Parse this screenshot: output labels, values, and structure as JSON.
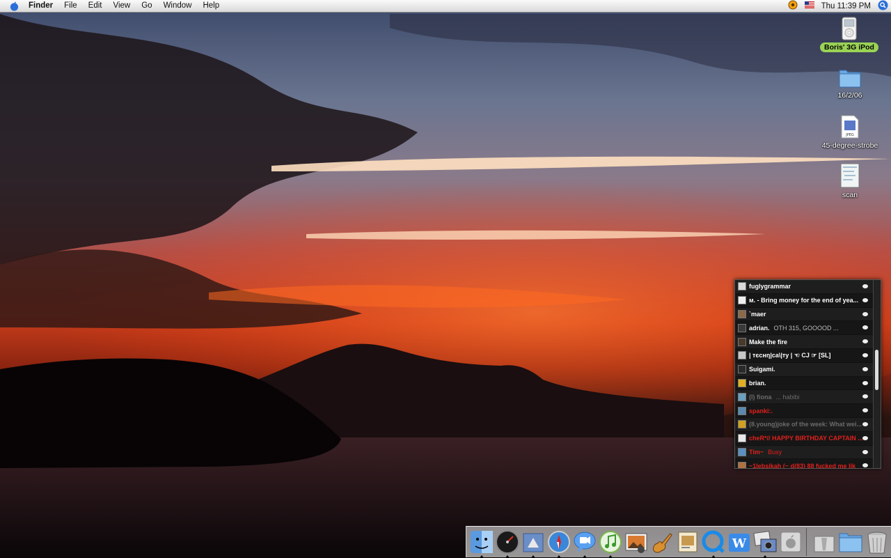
{
  "menubar": {
    "app_name": "Finder",
    "menus": [
      "File",
      "Edit",
      "View",
      "Go",
      "Window",
      "Help"
    ],
    "clock": "Thu 11:39 PM",
    "status_icons": [
      "sync-icon",
      "us-flag-icon",
      "spotlight-icon"
    ]
  },
  "desktop_icons": [
    {
      "label": "Boris' 3G iPod",
      "icon": "ipod-icon",
      "selected": true
    },
    {
      "label": "16/2/06",
      "icon": "folder-icon",
      "selected": false
    },
    {
      "label": "45-degree-strobe",
      "icon": "jpeg-file-icon",
      "selected": false
    },
    {
      "label": "scan",
      "icon": "image-file-icon",
      "selected": false
    }
  ],
  "buddy_list": {
    "buddies": [
      {
        "name": "fuglygrammar",
        "status": "",
        "state": "online",
        "avatar_color": "#d9d9d9"
      },
      {
        "name": "м. - Bring money for the end of yea...",
        "status": "",
        "state": "online",
        "avatar_color": "#f0f0f0"
      },
      {
        "name": "`maer",
        "status": "",
        "state": "online",
        "avatar_color": "#8b6a4a"
      },
      {
        "name": "adrian.",
        "status": "OTH 315,  GOOOOD ...",
        "state": "online",
        "avatar_color": "#3a3a3a"
      },
      {
        "name": "Make the fire",
        "status": "",
        "state": "online",
        "avatar_color": "#4a3a2a"
      },
      {
        "name": "| тєcнη|ca\\|тy | ☜ CJ ☞ [SL]",
        "status": "",
        "state": "online",
        "avatar_color": "#c8c8c8"
      },
      {
        "name": "Suigami.",
        "status": "",
        "state": "online",
        "avatar_color": "#2a2a2a"
      },
      {
        "name": "brian.",
        "status": "",
        "state": "online",
        "avatar_color": "#e0b020"
      },
      {
        "name": "(I) fiona",
        "status": "... habibi",
        "state": "idle",
        "avatar_color": "#6aa0c0"
      },
      {
        "name": "spanki:.",
        "status": "",
        "state": "red",
        "avatar_color": "#5a8ab0"
      },
      {
        "name": "(8.young)joke of the week: What wei...",
        "status": "",
        "state": "idle",
        "avatar_color": "#d0a020"
      },
      {
        "name": "cheR*// HAPPY BIRTHDAY CAPTAIN ...",
        "status": "",
        "state": "red",
        "avatar_color": "#e8e8e8"
      },
      {
        "name": "Tim~",
        "status": "Busy",
        "state": "red",
        "avatar_color": "#5a90c0"
      },
      {
        "name": "~1lebsikah (~ d(83) 88 fucked me lik",
        "status": "",
        "state": "red",
        "avatar_color": "#b07040"
      }
    ]
  },
  "dock": {
    "apps": [
      {
        "name": "Finder",
        "icon": "finder-icon",
        "running": true
      },
      {
        "name": "Dashboard",
        "icon": "dashboard-icon",
        "running": true
      },
      {
        "name": "Mail",
        "icon": "mail-icon",
        "running": true
      },
      {
        "name": "Safari",
        "icon": "safari-icon",
        "running": true
      },
      {
        "name": "iChat",
        "icon": "ichat-icon",
        "running": true
      },
      {
        "name": "iTunes",
        "icon": "itunes-icon",
        "running": true
      },
      {
        "name": "iPhoto",
        "icon": "iphoto-icon",
        "running": false
      },
      {
        "name": "GarageBand",
        "icon": "garageband-icon",
        "running": false
      },
      {
        "name": "Preview",
        "icon": "preview-icon",
        "running": false
      },
      {
        "name": "QuickTime Player",
        "icon": "quicktime-icon",
        "running": true
      },
      {
        "name": "Word",
        "icon": "word-icon",
        "running": false
      },
      {
        "name": "Image Capture",
        "icon": "image-capture-icon",
        "running": true
      },
      {
        "name": "Apple Store",
        "icon": "apple-logo-icon",
        "running": false
      }
    ],
    "right": [
      {
        "name": "Applications",
        "icon": "applications-icon"
      },
      {
        "name": "Documents",
        "icon": "documents-folder-icon"
      },
      {
        "name": "Trash",
        "icon": "trash-icon"
      }
    ]
  }
}
